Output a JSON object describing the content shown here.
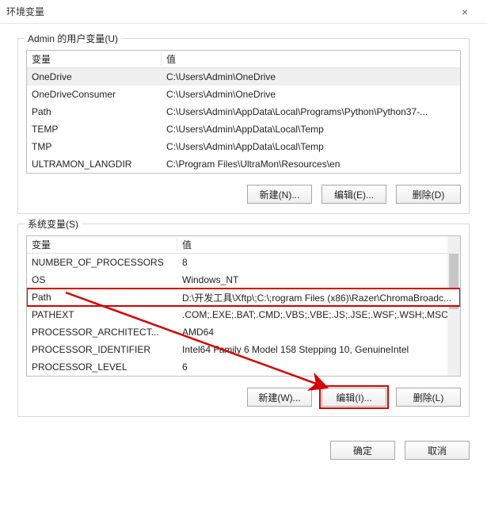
{
  "window": {
    "title": "环境变量",
    "close_icon": "×"
  },
  "user_vars": {
    "group_label": "Admin 的用户变量(U)",
    "header_name": "变量",
    "header_value": "值",
    "rows": [
      {
        "name": "OneDrive",
        "value": "C:\\Users\\Admin\\OneDrive",
        "selected": true
      },
      {
        "name": "OneDriveConsumer",
        "value": "C:\\Users\\Admin\\OneDrive",
        "selected": false
      },
      {
        "name": "Path",
        "value": "C:\\Users\\Admin\\AppData\\Local\\Programs\\Python\\Python37-...",
        "selected": false
      },
      {
        "name": "TEMP",
        "value": "C:\\Users\\Admin\\AppData\\Local\\Temp",
        "selected": false
      },
      {
        "name": "TMP",
        "value": "C:\\Users\\Admin\\AppData\\Local\\Temp",
        "selected": false
      },
      {
        "name": "ULTRAMON_LANGDIR",
        "value": "C:\\Program Files\\UltraMon\\Resources\\en",
        "selected": false
      }
    ],
    "buttons": {
      "new": "新建(N)...",
      "edit": "编辑(E)...",
      "delete": "删除(D)"
    }
  },
  "system_vars": {
    "group_label": "系统变量(S)",
    "header_name": "变量",
    "header_value": "值",
    "rows": [
      {
        "name": "NUMBER_OF_PROCESSORS",
        "value": "8",
        "selected": false
      },
      {
        "name": "OS",
        "value": "Windows_NT",
        "selected": false
      },
      {
        "name": "Path",
        "value": "D:\\开发工具\\Xftp\\;C:\\;rogram Files (x86)\\Razer\\ChromaBroadc...",
        "selected": true,
        "highlight": true
      },
      {
        "name": "PATHEXT",
        "value": ".COM;.EXE;.BAT;.CMD;.VBS;.VBE;.JS;.JSE;.WSF;.WSH;.MSC",
        "selected": false
      },
      {
        "name": "PROCESSOR_ARCHITECT...",
        "value": "AMD64",
        "selected": false
      },
      {
        "name": "PROCESSOR_IDENTIFIER",
        "value": "Intel64 Family 6 Model 158 Stepping 10, GenuineIntel",
        "selected": false
      },
      {
        "name": "PROCESSOR_LEVEL",
        "value": "6",
        "selected": false
      }
    ],
    "buttons": {
      "new": "新建(W)...",
      "edit": "编辑(I)...",
      "delete": "删除(L)"
    }
  },
  "footer": {
    "ok": "确定",
    "cancel": "取消"
  }
}
